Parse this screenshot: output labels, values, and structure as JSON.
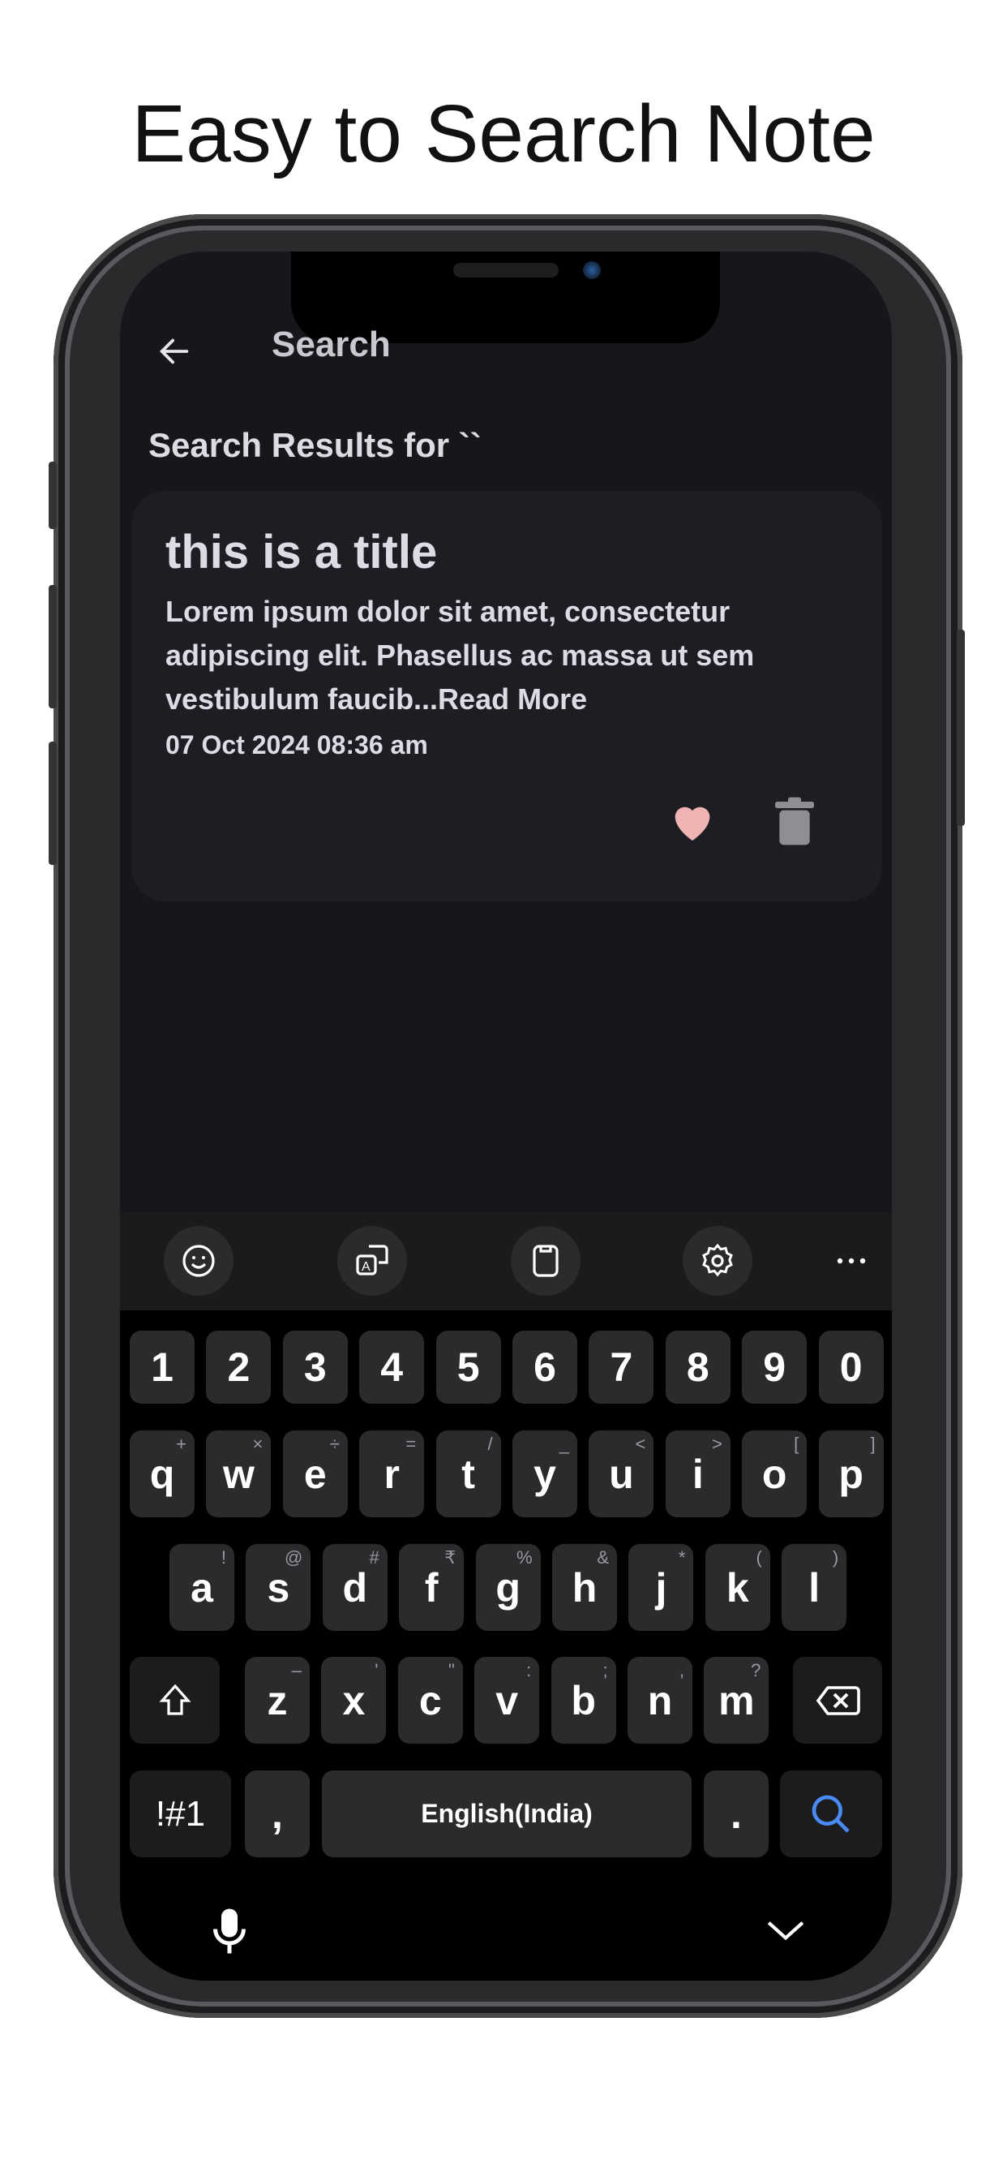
{
  "headline": "Easy to Search Note",
  "app": {
    "header_title": "Search",
    "results_heading": "Search Results for ``",
    "note": {
      "title": "this is a title",
      "body_lines": [
        "Lorem ipsum dolor sit amet, consectetur",
        "adipiscing elit. Phasellus ac massa ut sem",
        "vestibulum faucib...Read More"
      ],
      "date": "07 Oct 2024 08:36 am",
      "favorite_color": "#f0b4b4",
      "trash_color": "#8e8e93"
    }
  },
  "keyboard": {
    "toolbar": [
      "emoji-icon",
      "translate-icon",
      "clipboard-icon",
      "settings-icon",
      "more-icon"
    ],
    "numbers": [
      "1",
      "2",
      "3",
      "4",
      "5",
      "6",
      "7",
      "8",
      "9",
      "0"
    ],
    "row1": [
      [
        "q",
        "+"
      ],
      [
        "w",
        "×"
      ],
      [
        "e",
        "÷"
      ],
      [
        "r",
        "="
      ],
      [
        "t",
        "/"
      ],
      [
        "y",
        "_"
      ],
      [
        "u",
        "<"
      ],
      [
        "i",
        ">"
      ],
      [
        "o",
        "["
      ],
      [
        "p",
        "]"
      ]
    ],
    "row2": [
      [
        "a",
        "!"
      ],
      [
        "s",
        "@"
      ],
      [
        "d",
        "#"
      ],
      [
        "f",
        "₹"
      ],
      [
        "g",
        "%"
      ],
      [
        "h",
        "&"
      ],
      [
        "j",
        "*"
      ],
      [
        "k",
        "("
      ],
      [
        "l",
        ")"
      ]
    ],
    "row3": [
      [
        "z",
        "–"
      ],
      [
        "x",
        "'"
      ],
      [
        "c",
        "\""
      ],
      [
        "v",
        ":"
      ],
      [
        "b",
        ";"
      ],
      [
        "n",
        ","
      ],
      [
        "m",
        "?"
      ]
    ],
    "symbols_label": "!#1",
    "comma": ",",
    "space_label": "English(India)",
    "period": ".",
    "search_color": "#4a8af4"
  }
}
